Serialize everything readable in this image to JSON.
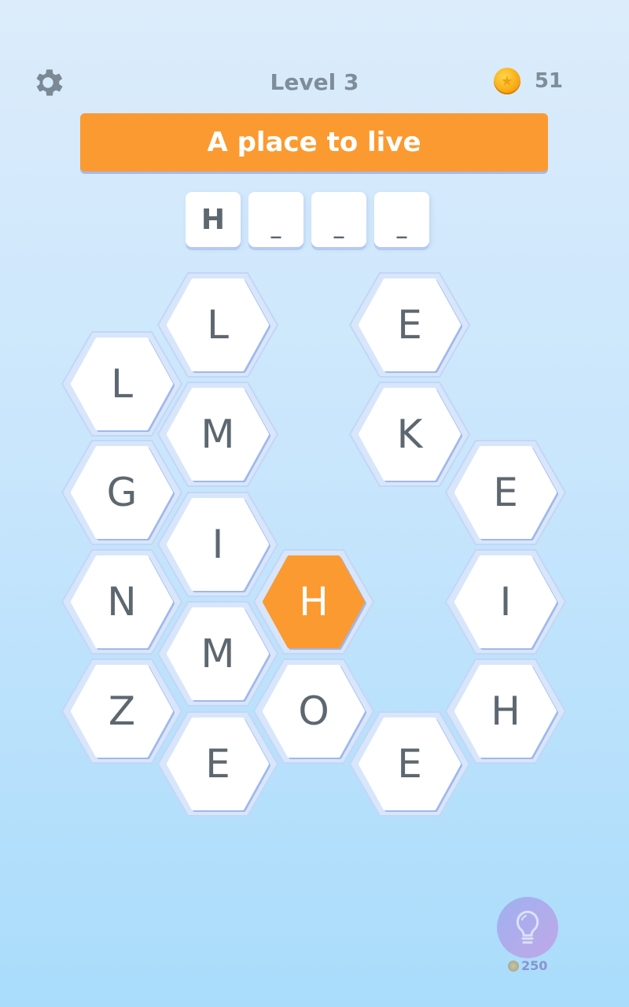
{
  "header": {
    "settings_icon": "gear-icon",
    "level_label": "Level 3",
    "coin_icon": "coin-icon",
    "coin_count": "51"
  },
  "clue": {
    "text": "A place to live"
  },
  "answer": {
    "slots": [
      "H",
      "_",
      "_",
      "_"
    ]
  },
  "colors": {
    "accent_orange": "#fb9a30",
    "hex_fill": "#ffffff",
    "letter": "#5d6770"
  },
  "board": {
    "tiles": [
      {
        "letter": "L",
        "selected": false
      },
      {
        "letter": "G",
        "selected": false
      },
      {
        "letter": "N",
        "selected": false
      },
      {
        "letter": "Z",
        "selected": false
      },
      {
        "letter": "L",
        "selected": false
      },
      {
        "letter": "M",
        "selected": false
      },
      {
        "letter": "I",
        "selected": false
      },
      {
        "letter": "M",
        "selected": false
      },
      {
        "letter": "E",
        "selected": false
      },
      {
        "letter": "H",
        "selected": true
      },
      {
        "letter": "O",
        "selected": false
      },
      {
        "letter": "E",
        "selected": false
      },
      {
        "letter": "K",
        "selected": false
      },
      {
        "letter": "E",
        "selected": false
      },
      {
        "letter": "E",
        "selected": false
      },
      {
        "letter": "I",
        "selected": false
      },
      {
        "letter": "H",
        "selected": false
      }
    ]
  },
  "hint": {
    "icon": "lightbulb-icon",
    "cost": "250"
  }
}
